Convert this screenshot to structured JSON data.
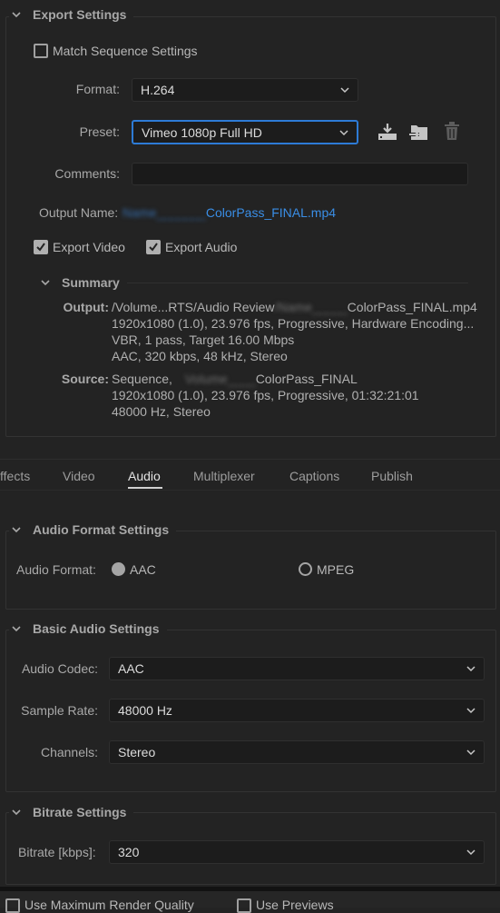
{
  "export_settings": {
    "title": "Export Settings",
    "match_sequence_label": "Match Sequence Settings",
    "match_sequence_checked": false,
    "format_label": "Format:",
    "format_value": "H.264",
    "preset_label": "Preset:",
    "preset_value": "Vimeo 1080p Full HD",
    "preset_icons": [
      "save-preset-icon",
      "import-preset-icon",
      "delete-preset-icon"
    ],
    "comments_label": "Comments:",
    "comments_value": "",
    "output_name_label": "Output Name:",
    "output_name_blurred": "Name_______",
    "output_name_value": "ColorPass_FINAL.mp4",
    "export_video_label": "Export Video",
    "export_video_checked": true,
    "export_audio_label": "Export Audio",
    "export_audio_checked": true
  },
  "summary": {
    "title": "Summary",
    "output_key": "Output:",
    "output_lines": [
      "/Volume...RTS/Audio Review",
      "ColorPass_FINAL.mp4",
      "1920x1080 (1.0), 23.976 fps, Progressive, Hardware Encoding...",
      "VBR, 1 pass, Target 16.00 Mbps",
      "AAC, 320 kbps, 48 kHz, Stereo"
    ],
    "output_blurred": "/Name_____",
    "source_key": "Source:",
    "source_lines": [
      "Sequence,",
      "ColorPass_FINAL",
      "1920x1080 (1.0), 23.976 fps, Progressive, 01:32:21:01",
      "48000 Hz, Stereo"
    ],
    "source_blurred": "Volume____"
  },
  "tabs": [
    {
      "label": "ffects",
      "active": false
    },
    {
      "label": "Video",
      "active": false
    },
    {
      "label": "Audio",
      "active": true
    },
    {
      "label": "Multiplexer",
      "active": false
    },
    {
      "label": "Captions",
      "active": false
    },
    {
      "label": "Publish",
      "active": false
    }
  ],
  "audio_format": {
    "title": "Audio Format Settings",
    "label": "Audio Format:",
    "options": [
      {
        "label": "AAC",
        "selected": true
      },
      {
        "label": "MPEG",
        "selected": false
      }
    ]
  },
  "basic_audio": {
    "title": "Basic Audio Settings",
    "codec_label": "Audio Codec:",
    "codec_value": "AAC",
    "sample_rate_label": "Sample Rate:",
    "sample_rate_value": "48000 Hz",
    "channels_label": "Channels:",
    "channels_value": "Stereo"
  },
  "bitrate": {
    "title": "Bitrate Settings",
    "label": "Bitrate [kbps]:",
    "value": "320"
  },
  "footer": {
    "max_quality_label": "Use Maximum Render Quality",
    "max_quality_checked": false,
    "use_previews_label": "Use Previews",
    "use_previews_checked": false
  },
  "colors": {
    "background": "#232323",
    "accent": "#2d7bd6",
    "link": "#3a8ee6"
  }
}
